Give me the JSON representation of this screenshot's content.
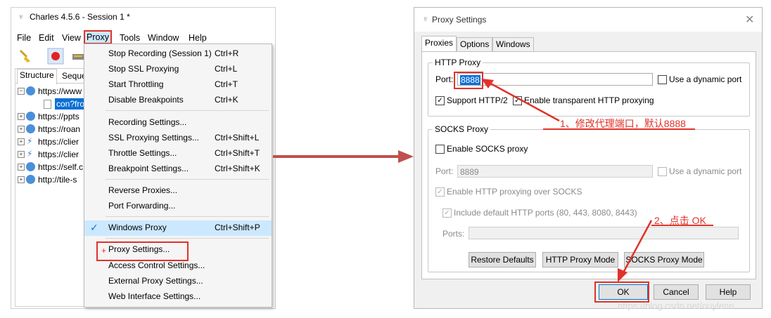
{
  "charles": {
    "title": "Charles 4.5.6 - Session 1 *",
    "menu": [
      "File",
      "Edit",
      "View",
      "Proxy",
      "Tools",
      "Window",
      "Help"
    ],
    "tabs": [
      "Structure",
      "Seque"
    ],
    "tree": [
      {
        "label": "https://www",
        "icon": "globe-icon",
        "expanded": true
      },
      {
        "label": "con?fron",
        "icon": "document-icon",
        "selected": true
      },
      {
        "label": "https://ppts",
        "icon": "globe-icon"
      },
      {
        "label": "https://roan",
        "icon": "globe-icon"
      },
      {
        "label": "https://clier",
        "icon": "bolt-icon"
      },
      {
        "label": "https://clier",
        "icon": "bolt-icon"
      },
      {
        "label": "https://self.c",
        "icon": "globe-icon"
      },
      {
        "label": "http://tile-s",
        "icon": "globe-icon"
      }
    ]
  },
  "proxy_menu": {
    "items": [
      {
        "label": "Stop Recording (Session 1)",
        "shortcut": "Ctrl+R"
      },
      {
        "label": "Stop SSL Proxying",
        "shortcut": "Ctrl+L"
      },
      {
        "label": "Start Throttling",
        "shortcut": "Ctrl+T"
      },
      {
        "label": "Disable Breakpoints",
        "shortcut": "Ctrl+K"
      },
      {
        "label": "Recording Settings...",
        "shortcut": ""
      },
      {
        "label": "SSL Proxying Settings...",
        "shortcut": "Ctrl+Shift+L"
      },
      {
        "label": "Throttle Settings...",
        "shortcut": "Ctrl+Shift+T"
      },
      {
        "label": "Breakpoint Settings...",
        "shortcut": "Ctrl+Shift+K"
      },
      {
        "label": "Reverse Proxies...",
        "shortcut": ""
      },
      {
        "label": "Port Forwarding...",
        "shortcut": ""
      },
      {
        "label": "Windows Proxy",
        "shortcut": "Ctrl+Shift+P",
        "checked": true
      },
      {
        "label": "Proxy Settings...",
        "shortcut": ""
      },
      {
        "label": "Access Control Settings...",
        "shortcut": ""
      },
      {
        "label": "External Proxy Settings...",
        "shortcut": ""
      },
      {
        "label": "Web Interface Settings...",
        "shortcut": ""
      }
    ]
  },
  "dialog": {
    "title": "Proxy Settings",
    "tabs": [
      "Proxies",
      "Options",
      "Windows"
    ],
    "http_proxy": {
      "group_title": "HTTP Proxy",
      "port_label": "Port:",
      "port_value": "8888",
      "dynamic_port_label": "Use a dynamic port",
      "support_http2_label": "Support HTTP/2",
      "support_http2_checked": true,
      "transparent_label": "Enable transparent HTTP proxying",
      "transparent_checked": true
    },
    "socks_proxy": {
      "group_title": "SOCKS Proxy",
      "enable_label": "Enable SOCKS proxy",
      "port_label": "Port:",
      "port_value": "8889",
      "dynamic_port_label": "Use a dynamic port",
      "http_over_socks_label": "Enable HTTP proxying over SOCKS",
      "include_ports_label": "Include default HTTP ports (80, 443, 8080, 8443)",
      "ports_label": "Ports:",
      "ports_value": ""
    },
    "mode_buttons": [
      "Restore Defaults",
      "HTTP Proxy Mode",
      "SOCKS Proxy Mode"
    ],
    "footer_buttons": {
      "ok": "OK",
      "cancel": "Cancel",
      "help": "Help"
    }
  },
  "annotations": {
    "step1": "1、修改代理端口，默认8888",
    "step2": "2、点击 OK",
    "color": "#e0322a"
  },
  "watermark": "https://blog.csdn.net/ouylenn"
}
